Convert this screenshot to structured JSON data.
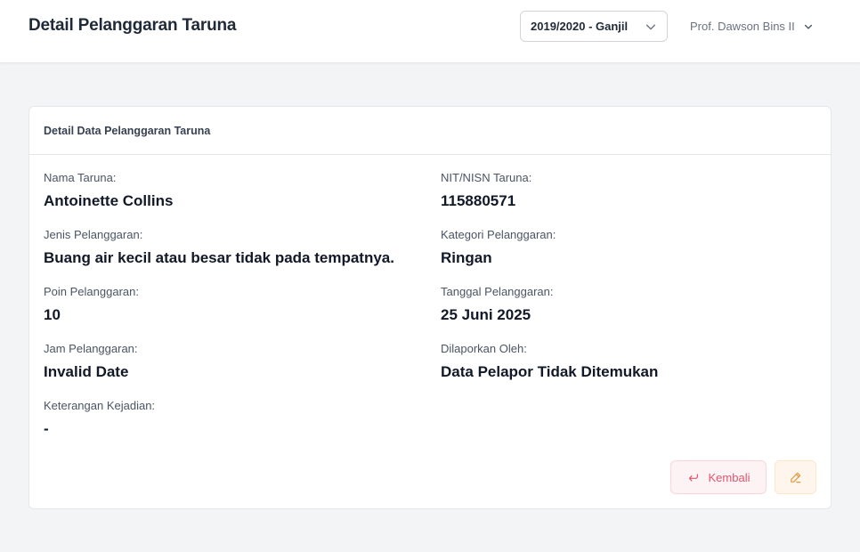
{
  "header": {
    "title": "Detail Pelanggaran Taruna",
    "semester": "2019/2020 - Ganjil",
    "user_name": "Prof. Dawson Bins II"
  },
  "card": {
    "title": "Detail Data Pelanggaran Taruna",
    "fields": [
      {
        "label": "Nama Taruna:",
        "value": "Antoinette Collins"
      },
      {
        "label": "NIT/NISN Taruna:",
        "value": "115880571"
      },
      {
        "label": "Jenis Pelanggaran:",
        "value": "Buang air kecil atau besar tidak pada tempatnya."
      },
      {
        "label": "Kategori Pelanggaran:",
        "value": "Ringan"
      },
      {
        "label": "Poin Pelanggaran:",
        "value": "10"
      },
      {
        "label": "Tanggal Pelanggaran:",
        "value": "25 Juni 2025"
      },
      {
        "label": "Jam Pelanggaran:",
        "value": "Invalid Date"
      },
      {
        "label": "Dilaporkan Oleh:",
        "value": "Data Pelapor Tidak Ditemukan"
      },
      {
        "label": "Keterangan Kejadian:",
        "value": "-"
      }
    ],
    "back_label": "Kembali"
  },
  "colors": {
    "back_text": "#e0556f",
    "edit_icon": "#e09a3e"
  },
  "icons": {
    "semester_dropdown": "chevron-down-icon",
    "user_dropdown": "chevron-down-icon",
    "back": "return-arrow-icon",
    "edit": "pencil-icon"
  }
}
